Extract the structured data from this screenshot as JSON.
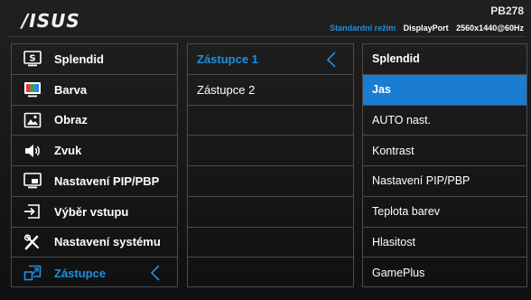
{
  "header": {
    "logo": "/ISUS",
    "model": "PB278",
    "mode": "Standardní režim",
    "input": "DisplayPort",
    "resolution": "2560x1440@60Hz"
  },
  "main_menu": {
    "items": [
      {
        "label": "Splendid",
        "icon": "splendid-icon"
      },
      {
        "label": "Barva",
        "icon": "color-icon"
      },
      {
        "label": "Obraz",
        "icon": "image-icon"
      },
      {
        "label": "Zvuk",
        "icon": "speaker-icon"
      },
      {
        "label": "Nastavení PIP/PBP",
        "icon": "pip-icon"
      },
      {
        "label": "Výběr vstupu",
        "icon": "input-select-icon"
      },
      {
        "label": "Nastavení systému",
        "icon": "tools-icon"
      },
      {
        "label": "Zástupce",
        "icon": "shortcut-icon"
      }
    ],
    "active_index": 7
  },
  "sub_menu": {
    "items": [
      {
        "label": "Zástupce 1"
      },
      {
        "label": "Zástupce 2"
      },
      {
        "label": ""
      },
      {
        "label": ""
      },
      {
        "label": ""
      },
      {
        "label": ""
      },
      {
        "label": ""
      },
      {
        "label": ""
      }
    ],
    "active_index": 0
  },
  "options": {
    "items": [
      {
        "label": "Splendid"
      },
      {
        "label": "Jas"
      },
      {
        "label": "AUTO nast."
      },
      {
        "label": "Kontrast"
      },
      {
        "label": "Nastavení PIP/PBP"
      },
      {
        "label": "Teplota barev"
      },
      {
        "label": "Hlasitost"
      },
      {
        "label": "GamePlus"
      }
    ],
    "title_index": 0,
    "selected_index": 1
  },
  "colors": {
    "accent": "#1e8fe0",
    "selected_bg": "#1a7dd1",
    "border": "#4c4c4c",
    "background": "#161616"
  }
}
